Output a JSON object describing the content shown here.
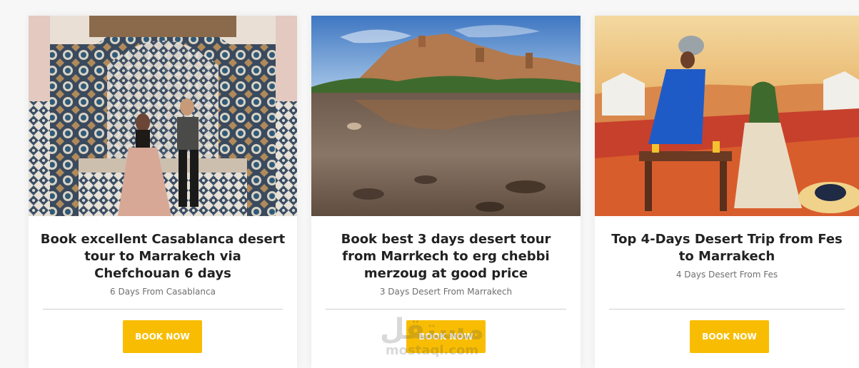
{
  "tours": [
    {
      "image_alt": "Couple sitting on a tiled bench in a Moroccan riad with zellige mosaic walls",
      "title": "Book excellent Casablanca desert tour to Marrakech via Chefchouan 6 days",
      "subtitle": "6 Days From Casablanca",
      "button_label": "BOOK NOW"
    },
    {
      "image_alt": "Ait Ben Haddou kasbah on a hill reflected in a river under blue sky",
      "title": "Book best 3 days desert tour from Marrkech to erg chebbi merzoug at good price",
      "subtitle": "3 Days Desert From Marrakech",
      "button_label": "BOOK NOW"
    },
    {
      "image_alt": "Man in blue robe serving tea to a woman at a desert camp table with rugs",
      "title": "Top 4-Days Desert Trip from Fes to Marrakech",
      "subtitle": "4 Days Desert From Fes",
      "button_label": "BOOK NOW"
    }
  ],
  "watermark": {
    "arabic": "مستقل",
    "latin": "mostaql.com"
  },
  "colors": {
    "accent": "#f8bd02",
    "title": "#222222",
    "subtitle": "#6f6f6f",
    "page_bg": "#f7f7f7"
  }
}
